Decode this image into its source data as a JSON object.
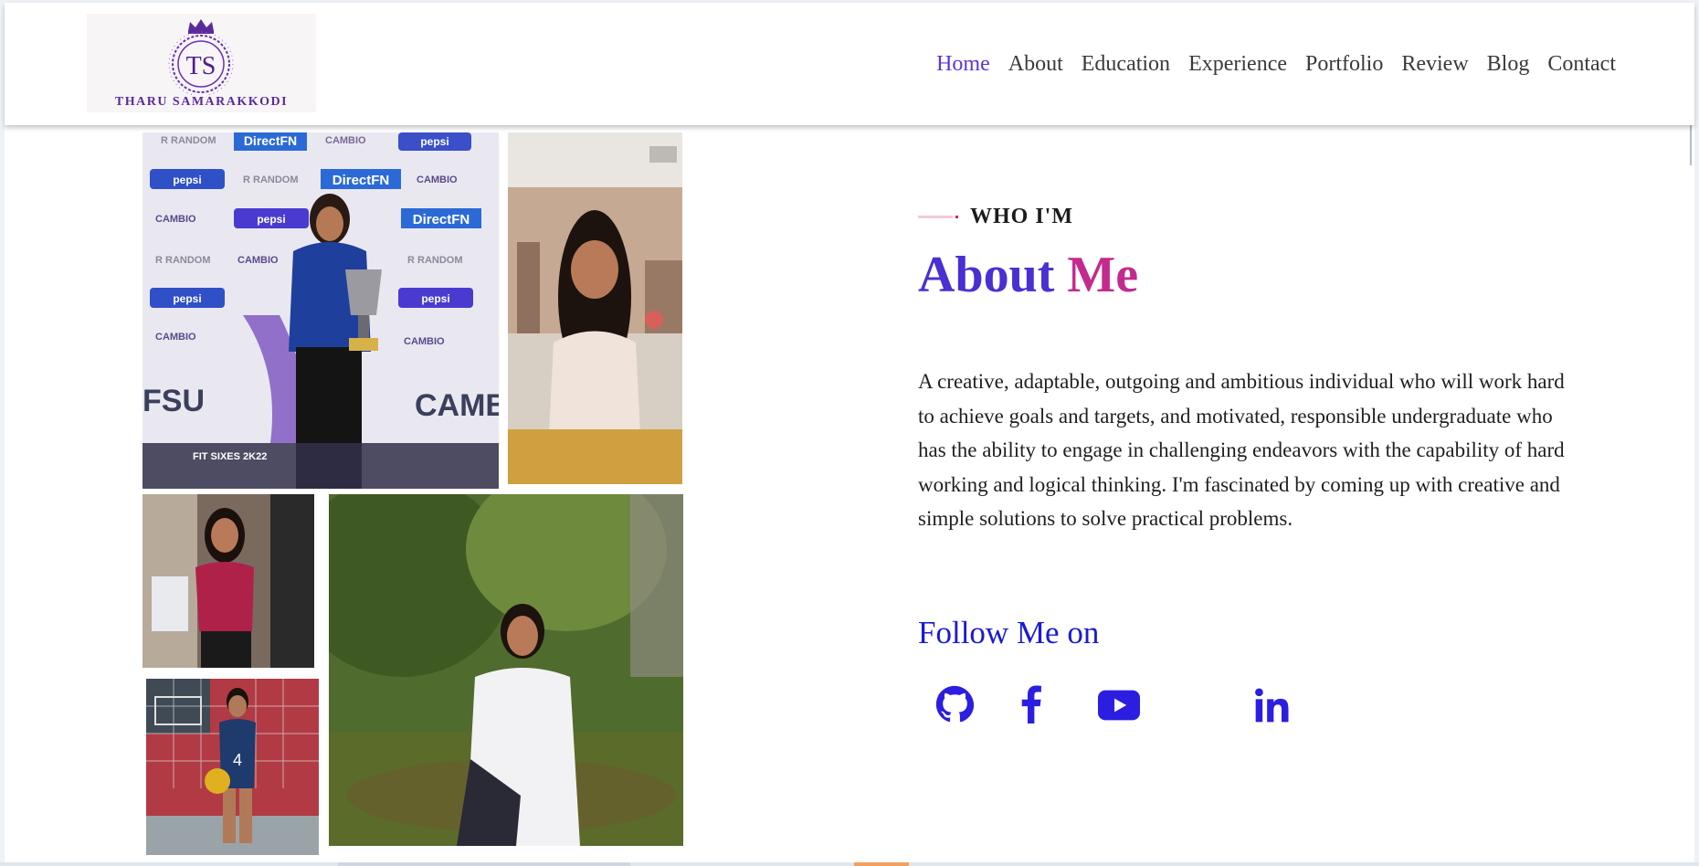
{
  "header": {
    "logo_initials": "TS",
    "logo_name": "THARU SAMARAKKODI",
    "nav": [
      {
        "label": "Home",
        "active": true
      },
      {
        "label": "About",
        "active": false
      },
      {
        "label": "Education",
        "active": false
      },
      {
        "label": "Experience",
        "active": false
      },
      {
        "label": "Portfolio",
        "active": false
      },
      {
        "label": "Review",
        "active": false
      },
      {
        "label": "Blog",
        "active": false
      },
      {
        "label": "Contact",
        "active": false
      }
    ]
  },
  "gallery": {
    "backdrop_logos": [
      "R RANDOM",
      "DirectFN",
      "CAMBIO",
      "pepsi"
    ],
    "event_caption": "FIT SIXES 2K22",
    "fsu_text": "FSU",
    "camb_text": "CAMB",
    "jersey_number": "4"
  },
  "about": {
    "eyebrow": "WHO I'M",
    "title_part1": "About",
    "title_part2": "Me",
    "description": "A creative, adaptable, outgoing and ambitious individual who will work hard to achieve goals and targets, and motivated, responsible undergraduate who has the ability to engage in challenging endeavors with the capability of hard working and logical thinking. I'm fascinated by coming up with creative and simple solutions to solve practical problems.",
    "follow_label": "Follow Me on"
  },
  "social": [
    {
      "icon": "github-icon"
    },
    {
      "icon": "facebook-icon"
    },
    {
      "icon": "youtube-icon"
    },
    {
      "icon": "linkedin-icon"
    }
  ],
  "colors": {
    "nav_active": "#5b36d6",
    "title_start": "#4a2fd3",
    "title_end": "#c42a8d",
    "follow": "#1a1ad8",
    "social_icon": "#2b1ee0"
  }
}
